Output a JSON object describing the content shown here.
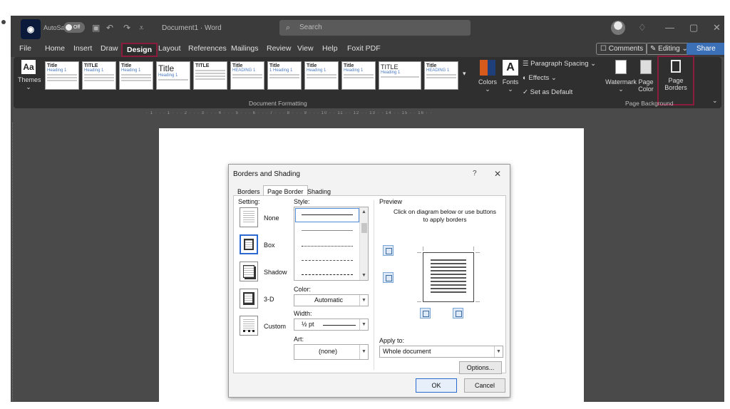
{
  "titlebar": {
    "autosave_label": "AutoSave",
    "autosave_state": "Off",
    "doc_title": "Document1 · Word",
    "search_placeholder": "Search"
  },
  "tabs": [
    "File",
    "Home",
    "Insert",
    "Draw",
    "Design",
    "Layout",
    "References",
    "Mailings",
    "Review",
    "View",
    "Help",
    "Foxit PDF"
  ],
  "active_tab": "Design",
  "header_buttons": {
    "comments": "Comments",
    "editing": "Editing",
    "share": "Share"
  },
  "ribbon": {
    "themes_label": "Themes",
    "style_thumbs": [
      "Title",
      "TITLE",
      "Title",
      "Title",
      "TITLE",
      "Title",
      "Title",
      "Title",
      "Title",
      "TITLE",
      "Title"
    ],
    "paragraph_spacing": "Paragraph Spacing",
    "effects": "Effects",
    "set_as_default": "Set as Default",
    "colors": "Colors",
    "fonts": "Fonts",
    "document_formatting": "Document Formatting",
    "watermark": "Watermark",
    "page_color": "Page Color",
    "page_borders": "Page Borders",
    "page_background": "Page Background"
  },
  "dialog": {
    "title": "Borders and Shading",
    "help": "?",
    "close": "✕",
    "tabs": [
      "Borders",
      "Page Border",
      "Shading"
    ],
    "active_tab": "Page Border",
    "setting_label": "Setting:",
    "settings": [
      "None",
      "Box",
      "Shadow",
      "3-D",
      "Custom"
    ],
    "selected_setting": "Box",
    "style_label": "Style:",
    "color_label": "Color:",
    "color_value": "Automatic",
    "width_label": "Width:",
    "width_value": "½ pt",
    "art_label": "Art:",
    "art_value": "(none)",
    "preview_label": "Preview",
    "preview_hint": "Click on diagram below or use buttons to apply borders",
    "apply_to_label": "Apply to:",
    "apply_to_value": "Whole document",
    "options": "Options...",
    "ok": "OK",
    "cancel": "Cancel"
  },
  "ruler_text": "· 1 · · · 1 · · · 2 · · · 3 · · · 4 · · · 5 · · · 6 · · · 7 · · · 8 · · · 9 · · · 10 · · 11 · · 12 · · 13 · · 14 · · 15 · · 16 · ·",
  "colors": {
    "highlight": "#8b1c3d",
    "share": "#3b6fb6",
    "selection": "#2a6ad0"
  }
}
